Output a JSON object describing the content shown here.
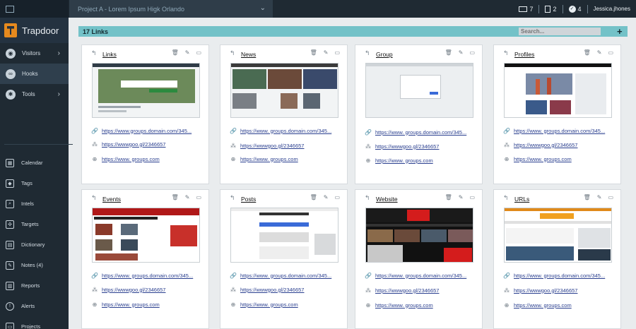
{
  "app": {
    "name": "Trapdoor"
  },
  "topbar": {
    "project": "Project A - Lorem Ipsum Higk Orlando",
    "mail_count": "7",
    "doc_count": "2",
    "check_count": "4",
    "user": "Jessica.jhones"
  },
  "sidebar": {
    "main": [
      {
        "label": "Visitors"
      },
      {
        "label": "Hooks"
      },
      {
        "label": "Tools"
      }
    ],
    "lower": [
      {
        "label": "Calendar"
      },
      {
        "label": "Tags"
      },
      {
        "label": "Intels"
      },
      {
        "label": "Targets"
      },
      {
        "label": "Dictionary"
      },
      {
        "label": "Notes (4)"
      },
      {
        "label": "Reports"
      },
      {
        "label": "Alerts"
      },
      {
        "label": "Projects"
      }
    ]
  },
  "content": {
    "header": "17 Links",
    "search_placeholder": "Search...",
    "add_label": "+"
  },
  "cards": [
    {
      "title": "Links",
      "url1": "https://www.groups.domain.com/345...",
      "url2": "https://wwwgoo.gl/2346657",
      "url3": "https://www. groups.com"
    },
    {
      "title": "News",
      "url1": "https://www. groups.domain.com/345...",
      "url2": "https://wwwgoo.gl/2346657",
      "url3": "https://www. groups.com"
    },
    {
      "title": "Group",
      "url1": "https://www. groups.domain.com/345...",
      "url2": "https://wwwgoo.gl/2346657",
      "url3": "https://www. groups.com"
    },
    {
      "title": "Profiles",
      "url1": "https://www. groups.domain.com/345...",
      "url2": "https://wwwgoo.gl/2346657",
      "url3": "https://www. groups.com"
    },
    {
      "title": "Events",
      "url1": "https://www. groups.domain.com/345...",
      "url2": "https://wwwgoo.gl/2346657",
      "url3": "https://www. groups.com"
    },
    {
      "title": "Posts",
      "url1": "https://www. groups.domain.com/345...",
      "url2": "https://wwwgoo.gl/2346657",
      "url3": "https://www. groups.com"
    },
    {
      "title": "Website",
      "url1": "https://www. groups.domain.com/345...",
      "url2": "https://wwwgoo.gl/2346657",
      "url3": "https://www. groups.com"
    },
    {
      "title": "URLs",
      "url1": "https://www. groups.domain.com/345...",
      "url2": "https://wwwgoo.gl/2346657",
      "url3": "https://www. groups.com"
    }
  ]
}
